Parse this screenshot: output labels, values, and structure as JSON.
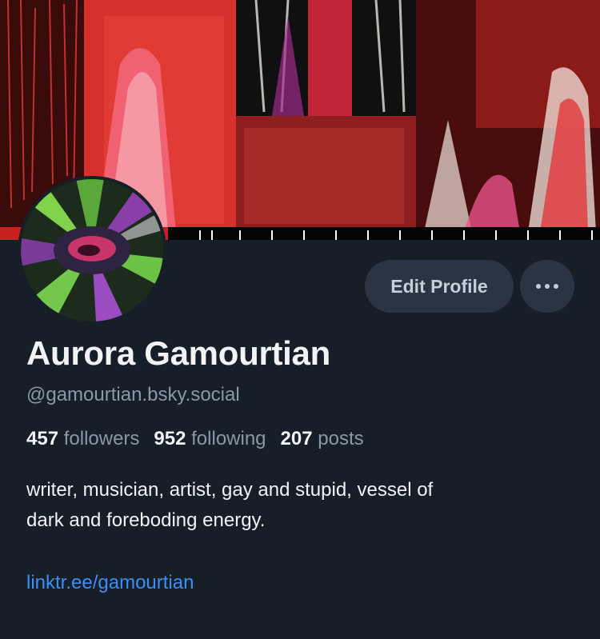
{
  "profile": {
    "banner_image": "red-glitch-art-banner",
    "avatar_image": "green-purple-glitch-art-avatar",
    "display_name": "Aurora Gamourtian",
    "handle": "@gamourtian.bsky.social",
    "stats": [
      {
        "count": "457",
        "label": "followers"
      },
      {
        "count": "952",
        "label": "following"
      },
      {
        "count": "207",
        "label": "posts"
      }
    ],
    "bio_lines": [
      "writer, musician, artist, gay and stupid, vessel of",
      "dark and foreboding energy."
    ],
    "link": "linktr.ee/gamourtian"
  },
  "actions": {
    "edit_profile_label": "Edit Profile",
    "more_icon": "ellipsis-icon"
  },
  "colors": {
    "background": "#161e27",
    "button": "#2a3442",
    "secondary_text": "#8b98a7",
    "link": "#3d8ef7"
  }
}
